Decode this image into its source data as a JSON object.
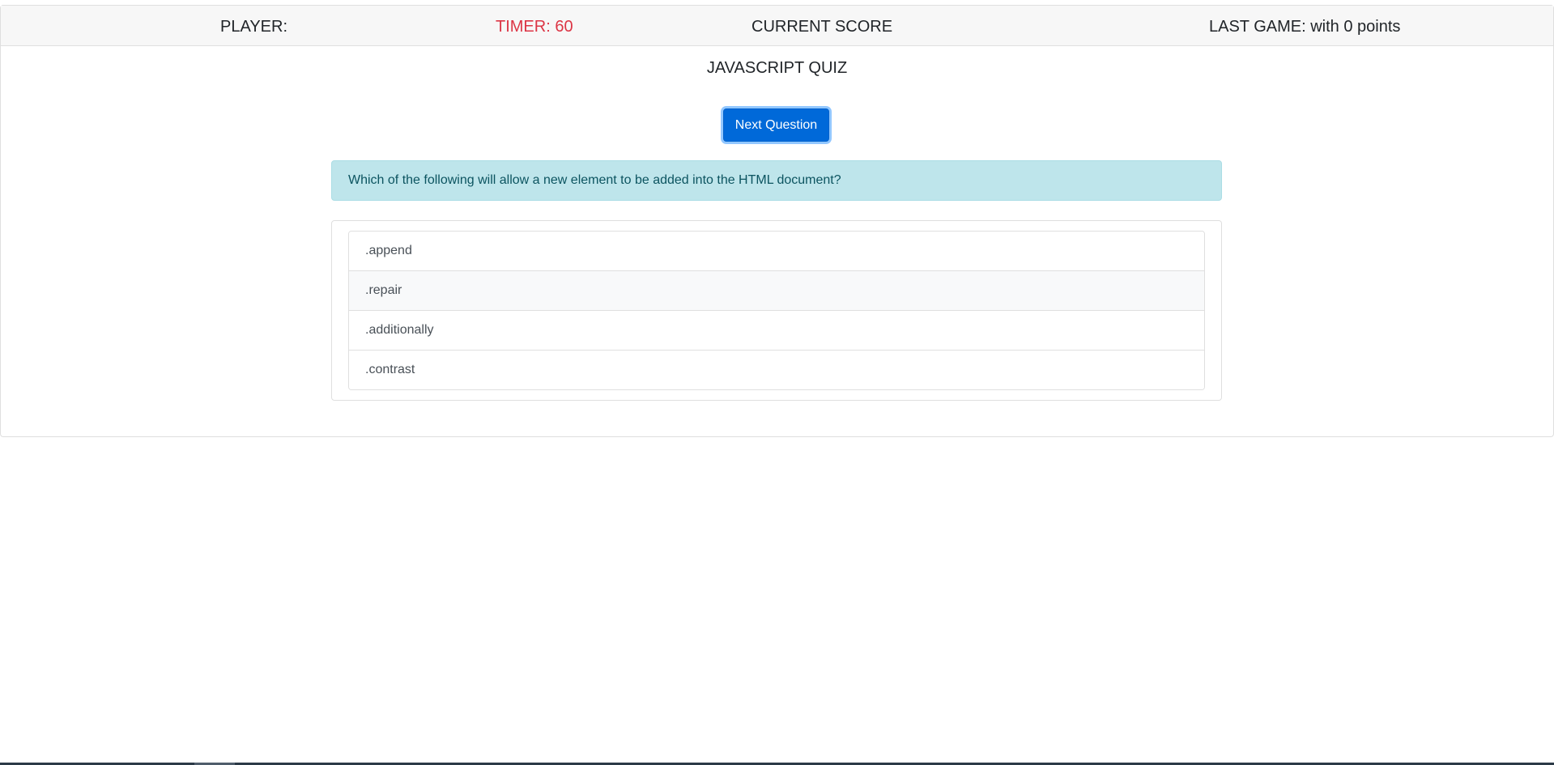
{
  "header": {
    "player": "PLAYER:",
    "timer": "TIMER: 60",
    "current_score": "CURRENT SCORE",
    "last_game": "LAST GAME: with 0 points"
  },
  "quiz": {
    "title": "JAVASCRIPT QUIZ",
    "next_button": "Next Question",
    "question": "Which of the following will allow a new element to be added into the HTML document?",
    "answers": [
      ".append",
      ".repair",
      ".additionally",
      ".contrast"
    ],
    "hovered_answer_index": 1
  },
  "colors": {
    "timer": "#dc3545",
    "primary_button": "#0069d9",
    "question_bg": "#bee5eb",
    "question_text": "#0c5460"
  }
}
